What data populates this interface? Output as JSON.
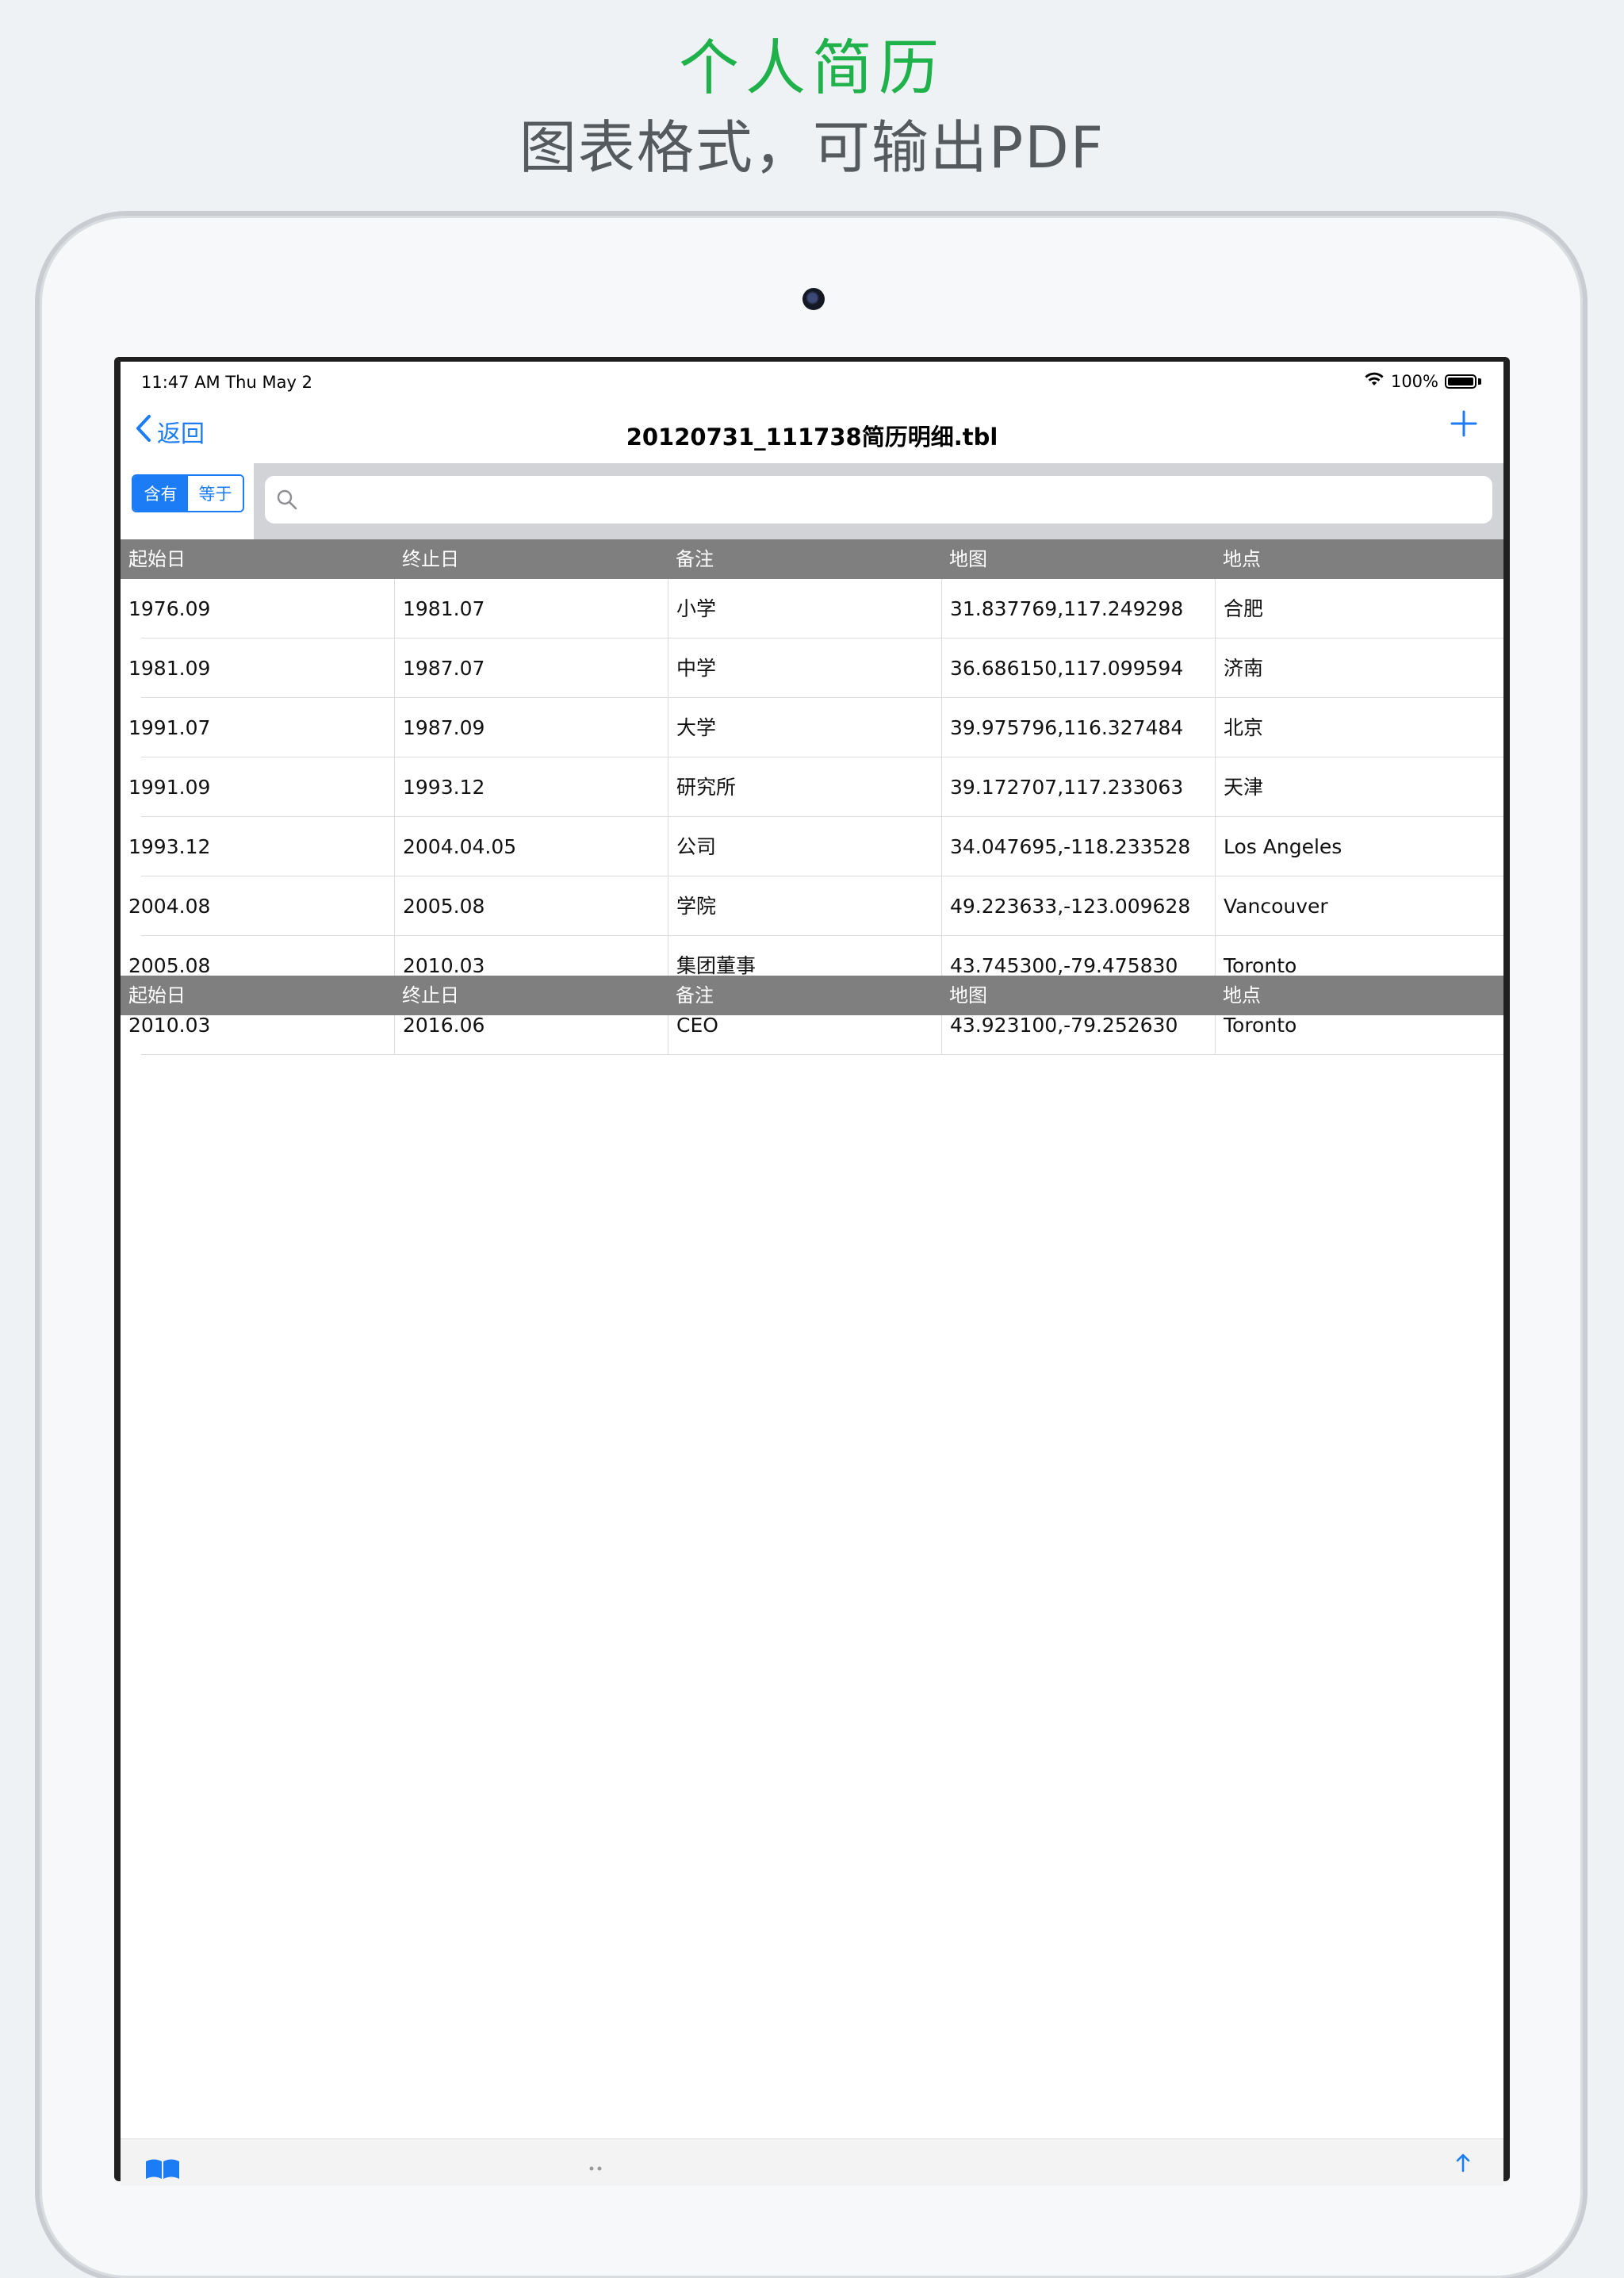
{
  "promo": {
    "title": "个人简历",
    "subtitle": "图表格式，可输出PDF"
  },
  "status_bar": {
    "time": "11:47 AM   Thu May 2",
    "battery": "100%"
  },
  "nav": {
    "back_label": "返回",
    "title": "20120731_111738简历明细.tbl"
  },
  "search": {
    "segments": [
      "含有",
      "等于"
    ],
    "selected_segment": "含有",
    "placeholder": "",
    "value": ""
  },
  "table": {
    "columns": [
      "起始日",
      "终止日",
      "备注",
      "地图",
      "地点"
    ],
    "rows": [
      [
        "1976.09",
        "1981.07",
        "小学",
        "31.837769,117.249298",
        "合肥"
      ],
      [
        "1981.09",
        "1987.07",
        "中学",
        "36.686150,117.099594",
        "济南"
      ],
      [
        "1991.07",
        "1987.09",
        "大学",
        "39.975796,116.327484",
        "北京"
      ],
      [
        "1991.09",
        "1993.12",
        "研究所",
        "39.172707,117.233063",
        "天津"
      ],
      [
        "1993.12",
        "2004.04.05",
        "公司",
        "34.047695,-118.233528",
        "Los Angeles"
      ],
      [
        "2004.08",
        "2005.08",
        "学院",
        "49.223633,-123.009628",
        "Vancouver"
      ],
      [
        "2005.08",
        "2010.03",
        "集团董事",
        "43.745300,-79.475830",
        "Toronto"
      ],
      [
        "2010.03",
        "2016.06",
        "CEO",
        "43.923100,-79.252630",
        "Toronto"
      ]
    ],
    "footer_columns": [
      "起始日",
      "终止日",
      "备注",
      "地图",
      "地点"
    ]
  },
  "colors": {
    "accent": "#1b7cf5",
    "promo_green": "#1fb24a",
    "header_gray": "#7f7f7f"
  },
  "icons": {
    "back": "chevron-left-icon",
    "add": "plus-icon",
    "search": "search-icon",
    "wifi": "wifi-icon",
    "battery": "battery-icon",
    "toolbar_left": "book-icon",
    "toolbar_right": "share-icon"
  }
}
